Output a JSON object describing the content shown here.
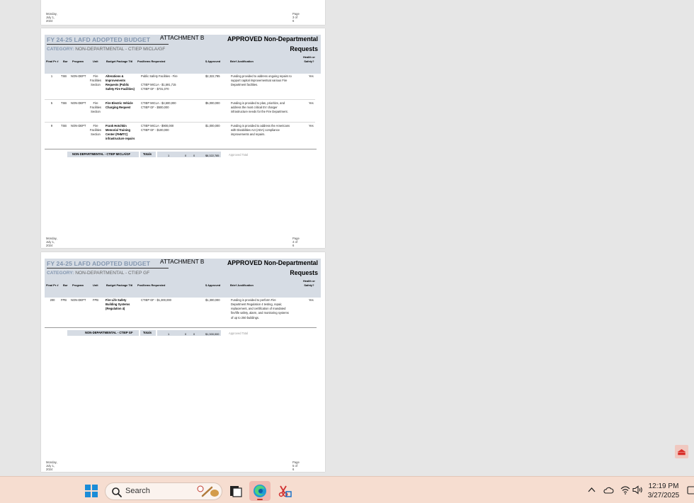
{
  "viewer": {
    "page_top": {
      "footer_date": "Monday, July 1, 2024",
      "footer_page": "Page 3 of 6"
    },
    "page4": {
      "budget_title": "FY 24-25 LAFD ADOPTED BUDGET",
      "attachment": "ATTACHMENT B",
      "approved_line1": "APPROVED Non-Departmental",
      "approved_line2": "Requests",
      "category_label": "CATEGORY:",
      "category_value": "NON-DEPARTMENTAL - CTIEP MICLA/GF",
      "columns": {
        "final_pr": "Final Pr #",
        "bur": "Bur",
        "program": "Program",
        "unit": "Unit",
        "budget_pkg": "Budget Package Titl",
        "pos_items": "Pos/Items Requested",
        "approved": "$ Approved",
        "justification": "Brief Justification",
        "health1": "Health or",
        "health2": "Safety?"
      },
      "rows": [
        {
          "final_pr": "1",
          "bur": "TSB",
          "program": "NON-DEPT",
          "unit": [
            "Fire",
            "Facilities",
            "Section"
          ],
          "title": [
            "Alterations &",
            "Improvements",
            "Requests (Public",
            "Safety Fire Facilities)"
          ],
          "items": [
            "Public Safety Facilities - Fire",
            "",
            "CTIEP MICLA - $1,591,715",
            "CTIEP GF - $731,070"
          ],
          "approved": "$2,322,785",
          "justification": [
            "Funding provided to address ongoing repairs to",
            "support capital improvementsat various Fire",
            "Department facilities."
          ],
          "health": "Yes"
        },
        {
          "final_pr": "5",
          "bur": "TSB",
          "program": "NON-DEPT",
          "unit": [
            "Fire",
            "Facilities",
            "Section"
          ],
          "title": [
            "Fire Electric Vehicle",
            "Charging Request"
          ],
          "items": [
            "CTIEP MICLA - $4,500,000",
            "CTIEP GF - $500,000"
          ],
          "approved": "$5,000,000",
          "justification": [
            "Funding is provided to plan, prioritize, and",
            "address the most critical EV charger",
            "infrastructure needs for the Fire Department."
          ],
          "health": "Yes"
        },
        {
          "final_pr": "9",
          "bur": "TSB",
          "program": "NON-DEPT",
          "unit": [
            "Fire",
            "Facilities",
            "Section"
          ],
          "title": [
            "Frank Hotchkin",
            "Memorial Training",
            "Center (FHMTC)",
            "infrastructure repairs"
          ],
          "items": [
            "CTIEP MICLA - $900,000",
            "CTIEP GF - $100,000"
          ],
          "approved": "$1,000,000",
          "justification": [
            "Funding is provided to address the Americans",
            "with Disabilities Act (ADA) compliance",
            "improvements and repairs."
          ],
          "health": "Yes"
        }
      ],
      "totals": {
        "label": "NON-DEPARTMENTAL - CTIEP MICLA/GF",
        "totals_word": "Totals",
        "n1": "1",
        "n2": "0",
        "n3": "0",
        "amount": "$8,322,785",
        "approved_total": "Approved Total"
      },
      "footer_date": "Monday, July 1, 2024",
      "footer_page": "Page 4 of 6"
    },
    "page5": {
      "budget_title": "FY 24-25 LAFD ADOPTED BUDGET",
      "attachment": "ATTACHMENT B",
      "approved_line1": "APPROVED Non-Departmental",
      "approved_line2": "Requests",
      "category_label": "CATEGORY:",
      "category_value": "NON-DEPARTMENTAL - CTIEP GF",
      "columns": {
        "final_pr": "Final Pr #",
        "bur": "Bur",
        "program": "Program",
        "unit": "Unit",
        "budget_pkg": "Budget Package Titl",
        "pos_items": "Pos/Items Requested",
        "approved": "$ Approved",
        "justification": "Brief Justification",
        "health1": "Health or",
        "health2": "Safety?"
      },
      "rows": [
        {
          "final_pr": "200",
          "bur": "FPB",
          "program": "NON-DEPT",
          "unit": [
            "FPB"
          ],
          "title": [
            "Fire Life Safety",
            "Building Systems",
            "(Regulation 4)"
          ],
          "items": [
            "CTIEP GF - $1,300,000"
          ],
          "approved": "$1,300,000",
          "justification": [
            "Funding is provided to perform Fire",
            "Department Regulation 4 testing, repair,",
            "replacement, and certification of mandated",
            "fire/life safety, alarm, and monitoring systems",
            "of up to 250 buildings."
          ],
          "health": "Yes"
        }
      ],
      "totals": {
        "label": "NON-DEPARTMENTAL - CTIEP GF",
        "totals_word": "Totals",
        "n1": "1",
        "n2": "0",
        "n3": "0",
        "amount": "$1,300,000",
        "approved_total": "Approved Total"
      },
      "footer_date": "Monday, July 1, 2024",
      "footer_page": "Page 5 of 6"
    }
  },
  "taskbar": {
    "search_label": "Search",
    "clock_time": "12:19 PM",
    "clock_date": "3/27/2025"
  },
  "colors": {
    "header_band": "#d6dce4",
    "title_blue_gray": "#8497b0",
    "taskbar": "#f6ddd0",
    "pdf_red": "#d9302b"
  },
  "icons": [
    "windows-start-icon",
    "search-icon",
    "task-view-icon",
    "edge-browser-icon",
    "snipping-tool-icon",
    "chevron-up-icon",
    "onedrive-cloud-icon",
    "wifi-icon",
    "volume-icon",
    "notification-icon",
    "pdf-icon"
  ]
}
